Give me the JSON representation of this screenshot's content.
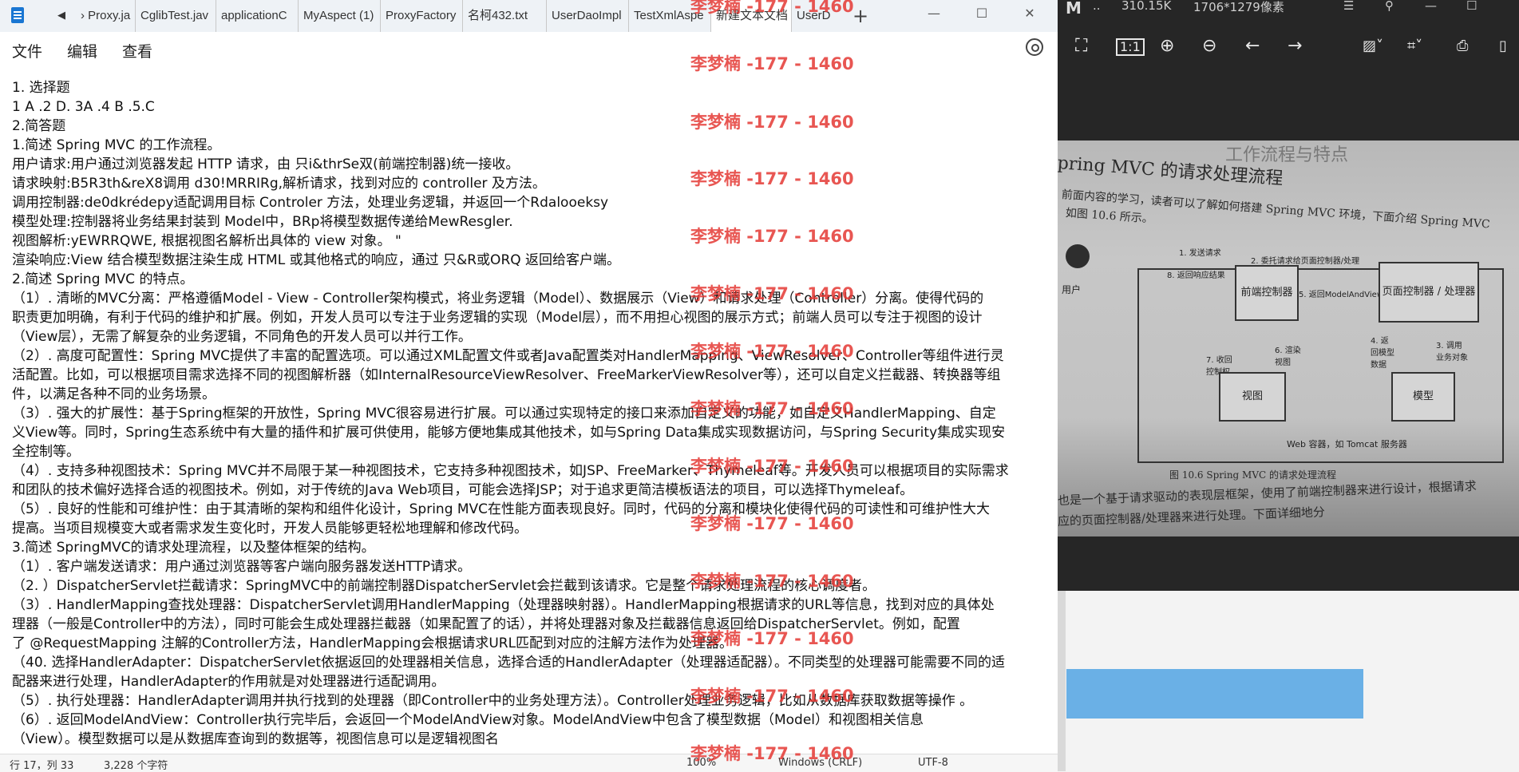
{
  "notepad": {
    "tabs": [
      "› Proxy.ja",
      "CglibTest.jav",
      "applicationC",
      "MyAspect (1)",
      "ProxyFactory",
      "名柯432.txt",
      "UserDaoImpl",
      "TestXmlAspe",
      "新建文本文档",
      "UserD"
    ],
    "add_tab": "+",
    "menu": [
      "文件",
      "编辑",
      "查看"
    ],
    "status": {
      "position": "行 17，列 33",
      "chars": "3,228 个字符",
      "zoom": "100%",
      "eol": "Windows (CRLF)",
      "encoding": "UTF-8"
    },
    "lines": [
      "1. 选择题",
      "1 A .2 D. 3A .4 B .5.C",
      "2.简答题",
      "1.简述 Spring MVC 的工作流程。",
      "用户请求:用户通过浏览器发起 HTTP 请求，由 只i&thrSe双(前端控制器)统一接收。",
      "请求映射:B5R3th&reX8调用 d30!MRRIRg,解析请求，找到对应的 controller 及方法。",
      "调用控制器:de0dkrédepy适配调用目标 Controler 方法，处理业务逻辑，并返回一个Rdalooeksy",
      "模型处理:控制器将业务结果封装到 Model中，BRp将模型数据传递给MewResgler.",
      "视图解析:yEWRRQWE, 根据视图名解析出具体的 view 对象。 \"",
      "渲染响应:View 结合模型数据注染生成 HTML 或其他格式的响应，通过 只&R或ORQ 返回给客户端。",
      "2.简述 Spring MVC 的特点。",
      "（1）. 清晰的MVC分离：严格遵循Model - View - Controller架构模式，将业务逻辑（Model）、数据展示（View）和请求处理（Controller）分离。使得代码的",
      "职责更加明确，有利于代码的维护和扩展。例如，开发人员可以专注于业务逻辑的实现（Model层），而不用担心视图的展示方式；前端人员可以专注于视图的设计",
      "（View层），无需了解复杂的业务逻辑，不同角色的开发人员可以并行工作。",
      "（2）. 高度可配置性：Spring MVC提供了丰富的配置选项。可以通过XML配置文件或者Java配置类对HandlerMapping、ViewResolver、Controller等组件进行灵",
      "活配置。比如，可以根据项目需求选择不同的视图解析器（如InternalResourceViewResolver、FreeMarkerViewResolver等），还可以自定义拦截器、转换器等组",
      "件，以满足各种不同的业务场景。",
      "（3）. 强大的扩展性：基于Spring框架的开放性，Spring MVC很容易进行扩展。可以通过实现特定的接口来添加自定义的功能，如自定义HandlerMapping、自定",
      "义View等。同时，Spring生态系统中有大量的插件和扩展可供使用，能够方便地集成其他技术，如与Spring Data集成实现数据访问，与Spring Security集成实现安",
      "全控制等。",
      "（4）. 支持多种视图技术：Spring MVC并不局限于某一种视图技术，它支持多种视图技术，如JSP、FreeMarker、Thymeleaf等。开发人员可以根据项目的实际需求",
      "和团队的技术偏好选择合适的视图技术。例如，对于传统的Java Web项目，可能会选择JSP；对于追求更简洁模板语法的项目，可以选择Thymeleaf。",
      "（5）. 良好的性能和可维护性：由于其清晰的架构和组件化设计，Spring MVC在性能方面表现良好。同时，代码的分离和模块化使得代码的可读性和可维护性大大",
      "提高。当项目规模变大或者需求发生变化时，开发人员能够更轻松地理解和修改代码。",
      "3.简述 SpringMVC的请求处理流程，以及整体框架的结构。",
      "（1）. 客户端发送请求：用户通过浏览器等客户端向服务器发送HTTP请求。",
      "（2. ）DispatcherServlet拦截请求：SpringMVC中的前端控制器DispatcherServlet会拦截到该请求。它是整个请求处理流程的核心调度者。",
      "（3）. HandlerMapping查找处理器：DispatcherServlet调用HandlerMapping（处理器映射器）。HandlerMapping根据请求的URL等信息，找到对应的具体处",
      "理器（一般是Controller中的方法），同时可能会生成处理器拦截器（如果配置了的话），并将处理器对象及拦截器信息返回给DispatcherServlet。例如，配置",
      "了 @RequestMapping 注解的Controller方法，HandlerMapping会根据请求URL匹配到对应的注解方法作为处理器。",
      "（40. 选择HandlerAdapter：DispatcherServlet依据返回的处理器相关信息，选择合适的HandlerAdapter（处理器适配器）。不同类型的处理器可能需要不同的适",
      "配器来进行处理，HandlerAdapter的作用就是对处理器进行适配调用。",
      "（5）. 执行处理器：HandlerAdapter调用并执行找到的处理器（即Controller中的业务处理方法）。Controller处理业务逻辑，比如从数据库获取数据等操作 。",
      "（6）. 返回ModelAndView：Controller执行完毕后，会返回一个ModelAndView对象。ModelAndView中包含了模型数据（Model）和视图相关信息",
      "（View）。模型数据可以是从数据库查询到的数据等，视图信息可以是逻辑视图名"
    ]
  },
  "watermark": "李梦楠 -177 - 1460",
  "viewer": {
    "logo": "M",
    "dots": "..",
    "file_size": "310.15K",
    "dimensions": "1706*1279像素",
    "icons": [
      "fullscreen-icon",
      "actual-size-icon",
      "zoom-in-icon",
      "zoom-out-icon",
      "prev-icon",
      "next-icon",
      "image-edit-icon",
      "crop-icon",
      "print-icon",
      "more-icon"
    ],
    "photo": {
      "header": "pring MVC 的请求处理流程",
      "heading_faded": "工作流程与特点",
      "intro_1": "前面内容的学习，读者可以了解如何搭建 Spring MVC 环境，下面介绍 Spring MVC",
      "intro_2": "如图 10.6 所示。",
      "user": "用户",
      "step1": "1. 发送请求",
      "step2": "2. 委托请求给页面控制器/处理器",
      "step8": "8. 返回响应结果",
      "step5": "5. 返回ModelAndView",
      "front_controller": "前端控制器",
      "page_controller": "页面控制器 / 处理器",
      "step7": "7. 收回控制权",
      "step6": "6. 渲染视图",
      "step4": "4. 返回模型数据",
      "step3": "3. 调用业务对象",
      "view": "视图",
      "model": "模型",
      "container": "Web 容器，如 Tomcat 服务器",
      "caption": "图 10.6   Spring MVC 的请求处理流程",
      "footer_1": "也是一个基于请求驱动的表现层框架，使用了前端控制器来进行设计，根据请求",
      "footer_2": "应的页面控制器/处理器来进行处理。下面详细地分"
    }
  }
}
